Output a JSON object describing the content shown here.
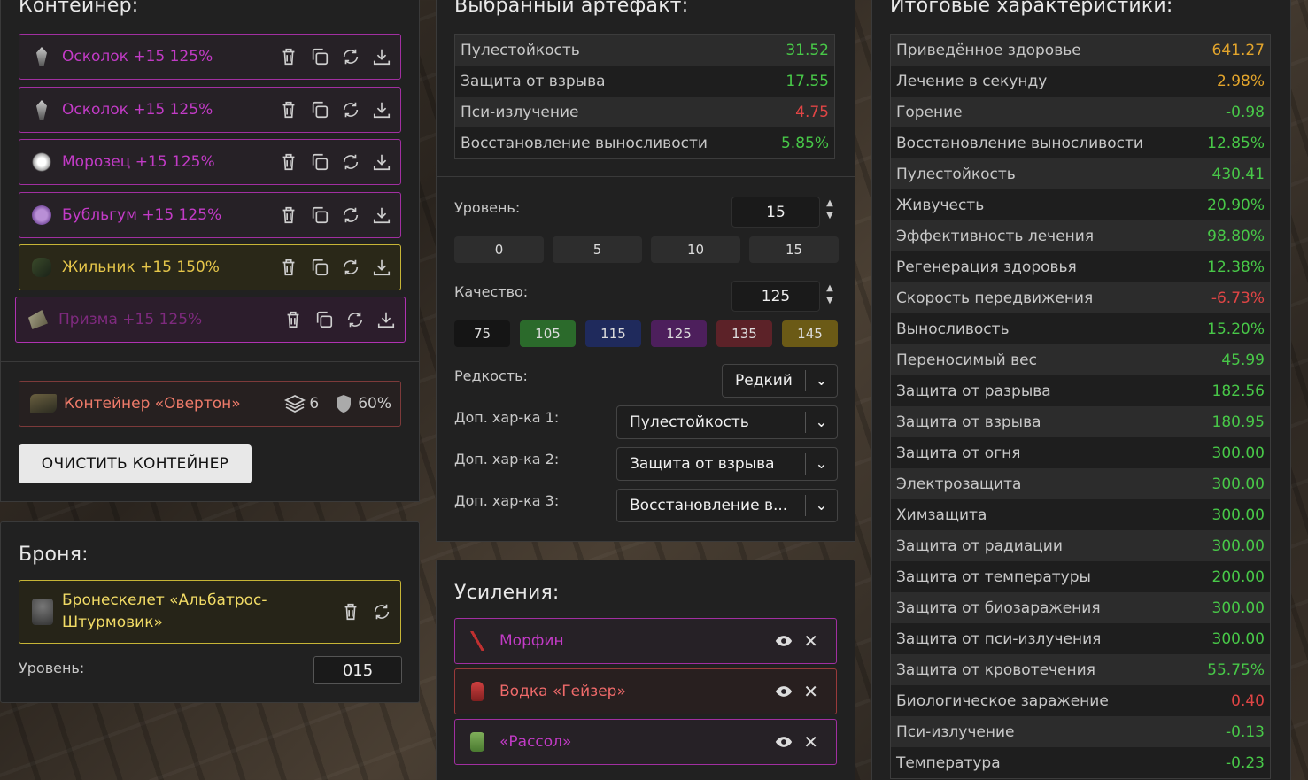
{
  "container": {
    "title": "Контейнер:",
    "slots": [
      {
        "name": "Осколок +15 125%",
        "icon": "shard-icon"
      },
      {
        "name": "Осколок +15 125%",
        "icon": "shard-icon"
      },
      {
        "name": "Морозец +15 125%",
        "icon": "frost-orb-icon"
      },
      {
        "name": "Бубльгум +15 125%",
        "icon": "bubblegum-icon"
      },
      {
        "name": "Жильник +15 150%",
        "icon": "vein-icon"
      },
      {
        "name": "Призма +15 125%",
        "icon": "prism-icon"
      }
    ],
    "box": {
      "name": "Контейнер «Овертон»",
      "slots": "6",
      "protection": "60%"
    },
    "clear_label": "ОЧИСТИТЬ КОНТЕЙНЕР"
  },
  "armor": {
    "title": "Броня:",
    "name_line1": "Бронескелет «Альбатрос-",
    "name_line2": "Штурмовик»",
    "level_label": "Уровень:",
    "level_value": "015"
  },
  "artifact": {
    "title": "Выбранный артефакт:",
    "stats": [
      {
        "name": "Пулестойкость",
        "value": "31.52",
        "color": "g"
      },
      {
        "name": "Защита от взрыва",
        "value": "17.55",
        "color": "g"
      },
      {
        "name": "Пси-излучение",
        "value": "4.75",
        "color": "r"
      },
      {
        "name": "Восстановление выносливости",
        "value": "5.85%",
        "color": "g"
      }
    ],
    "level_label": "Уровень:",
    "level_value": "15",
    "level_chips": [
      "0",
      "5",
      "10",
      "15"
    ],
    "quality_label": "Качество:",
    "quality_value": "125",
    "quality_chips": [
      {
        "v": "75",
        "c": "#151515"
      },
      {
        "v": "105",
        "c": "#2b6a2b"
      },
      {
        "v": "115",
        "c": "#1f2a5c"
      },
      {
        "v": "125",
        "c": "#4d1f5c"
      },
      {
        "v": "135",
        "c": "#5c2228"
      },
      {
        "v": "145",
        "c": "#6b5a16"
      }
    ],
    "rarity_label": "Редкость:",
    "rarity_value": "Редкий",
    "extra1_label": "Доп. хар-ка 1:",
    "extra1_value": "Пулестойкость",
    "extra2_label": "Доп. хар-ка 2:",
    "extra2_value": "Защита от взрыва",
    "extra3_label": "Доп. хар-ка 3:",
    "extra3_value": "Восстановление в..."
  },
  "boosts": {
    "title": "Усиления:",
    "items": [
      {
        "name": "Морфин",
        "color": "#c23bc6",
        "icon": "syringe-icon"
      },
      {
        "name": "Водка «Гейзер»",
        "color": "#ef6a6a",
        "icon": "bottle-icon"
      },
      {
        "name": "«Рассол»",
        "color": "#c23bc6",
        "icon": "jar-icon"
      }
    ]
  },
  "totals": {
    "title": "Итоговые характеристики:",
    "stats": [
      {
        "name": "Приведённое здоровье",
        "value": "641.27",
        "color": "o"
      },
      {
        "name": "Лечение в секунду",
        "value": "2.98%",
        "color": "o"
      },
      {
        "name": "Горение",
        "value": "-0.98",
        "color": "g"
      },
      {
        "name": "Восстановление выносливости",
        "value": "12.85%",
        "color": "g"
      },
      {
        "name": "Пулестойкость",
        "value": "430.41",
        "color": "g"
      },
      {
        "name": "Живучесть",
        "value": "20.90%",
        "color": "g"
      },
      {
        "name": "Эффективность лечения",
        "value": "98.80%",
        "color": "g"
      },
      {
        "name": "Регенерация здоровья",
        "value": "12.38%",
        "color": "g"
      },
      {
        "name": "Скорость передвижения",
        "value": "-6.73%",
        "color": "r"
      },
      {
        "name": "Выносливость",
        "value": "15.20%",
        "color": "g"
      },
      {
        "name": "Переносимый вес",
        "value": "45.99",
        "color": "g"
      },
      {
        "name": "Защита от разрыва",
        "value": "182.56",
        "color": "g"
      },
      {
        "name": "Защита от взрыва",
        "value": "180.95",
        "color": "g"
      },
      {
        "name": "Защита от огня",
        "value": "300.00",
        "color": "g"
      },
      {
        "name": "Электрозащита",
        "value": "300.00",
        "color": "g"
      },
      {
        "name": "Химзащита",
        "value": "300.00",
        "color": "g"
      },
      {
        "name": "Защита от радиации",
        "value": "300.00",
        "color": "g"
      },
      {
        "name": "Защита от температуры",
        "value": "200.00",
        "color": "g"
      },
      {
        "name": "Защита от биозаражения",
        "value": "300.00",
        "color": "g"
      },
      {
        "name": "Защита от пси-излучения",
        "value": "300.00",
        "color": "g"
      },
      {
        "name": "Защита от кровотечения",
        "value": "55.75%",
        "color": "g"
      },
      {
        "name": "Биологическое заражение",
        "value": "0.40",
        "color": "r"
      },
      {
        "name": "Пси-излучение",
        "value": "-0.13",
        "color": "g"
      },
      {
        "name": "Температура",
        "value": "-0.23",
        "color": "g"
      }
    ]
  }
}
